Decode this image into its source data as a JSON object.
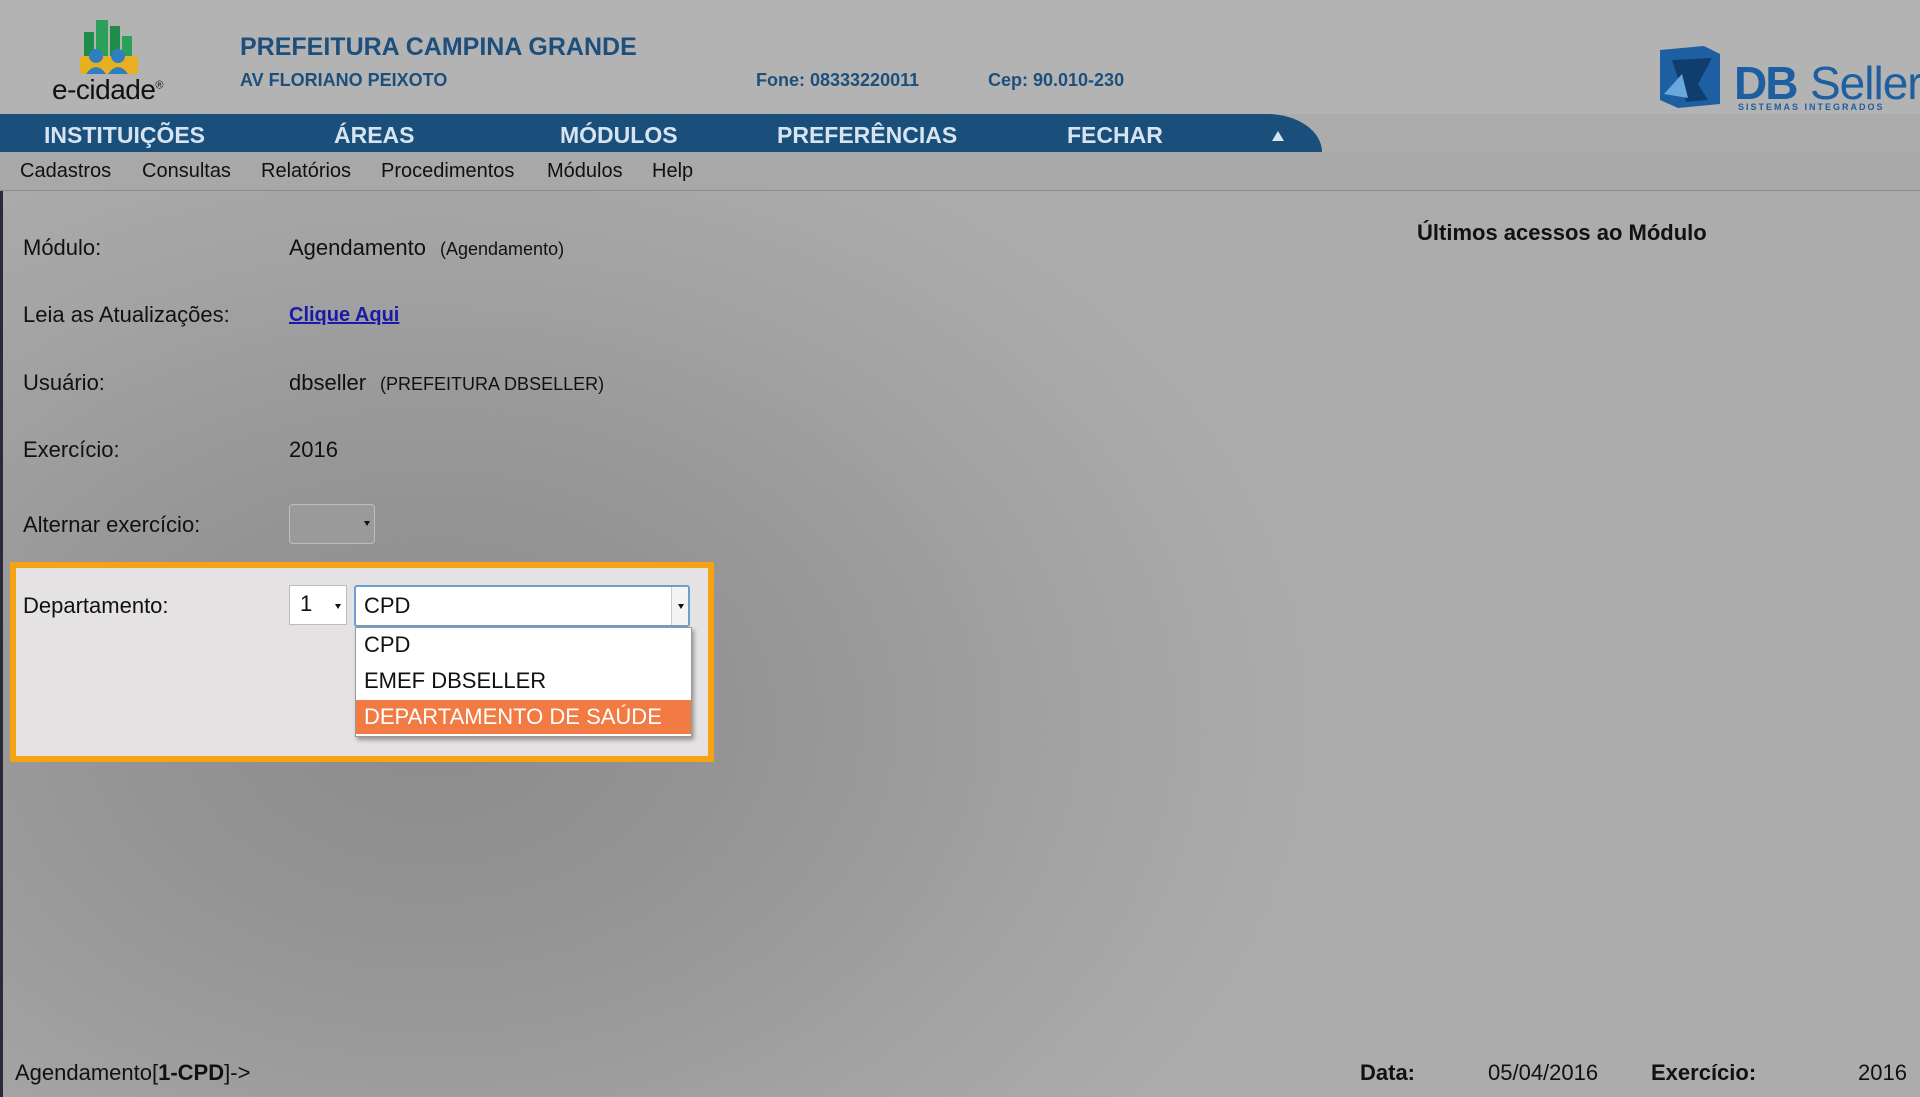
{
  "header": {
    "logo_text": "e-cidade",
    "org_name": "PREFEITURA CAMPINA GRANDE",
    "address": "AV FLORIANO PEIXOTO",
    "phone": "Fone: 08333220011",
    "cep": "Cep: 90.010-230",
    "brand_db": "DB",
    "brand_seller": "Seller",
    "brand_tag": "SISTEMAS INTEGRADOS"
  },
  "nav": {
    "items": [
      "INSTITUIÇÕES",
      "ÁREAS",
      "MÓDULOS",
      "PREFERÊNCIAS",
      "FECHAR"
    ]
  },
  "menu": {
    "items": [
      "Cadastros",
      "Consultas",
      "Relatórios",
      "Procedimentos",
      "Módulos",
      "Help"
    ]
  },
  "info": {
    "modulo_label": "Módulo:",
    "modulo_value": "Agendamento",
    "modulo_sub": "(Agendamento)",
    "atualizacoes_label": "Leia as Atualizações:",
    "atualizacoes_link": "Clique Aqui",
    "usuario_label": "Usuário:",
    "usuario_value": "dbseller",
    "usuario_sub": "(PREFEITURA DBSELLER)",
    "exercicio_label": "Exercício:",
    "exercicio_value": "2016",
    "alternar_label": "Alternar exercício:",
    "recent_title": "Últimos acessos ao Módulo"
  },
  "departamento": {
    "label": "Departamento:",
    "number": "1",
    "selected": "CPD",
    "options": [
      "CPD",
      "EMEF DBSELLER",
      "DEPARTAMENTO DE SAÚDE"
    ],
    "highlighted_index": 2
  },
  "status": {
    "context_prefix": "Agendamento[",
    "context_bold": "1-CPD",
    "context_suffix": "]->",
    "date_label": "Data:",
    "date_value": "05/04/2016",
    "exercicio_label": "Exercício:",
    "exercicio_value": "2016"
  },
  "colors": {
    "nav_bg": "#1a4f7c",
    "org_text": "#1d4f7c",
    "highlight_border": "#f6a313",
    "option_highlight": "#f27a43",
    "link": "#1a1aa8"
  }
}
